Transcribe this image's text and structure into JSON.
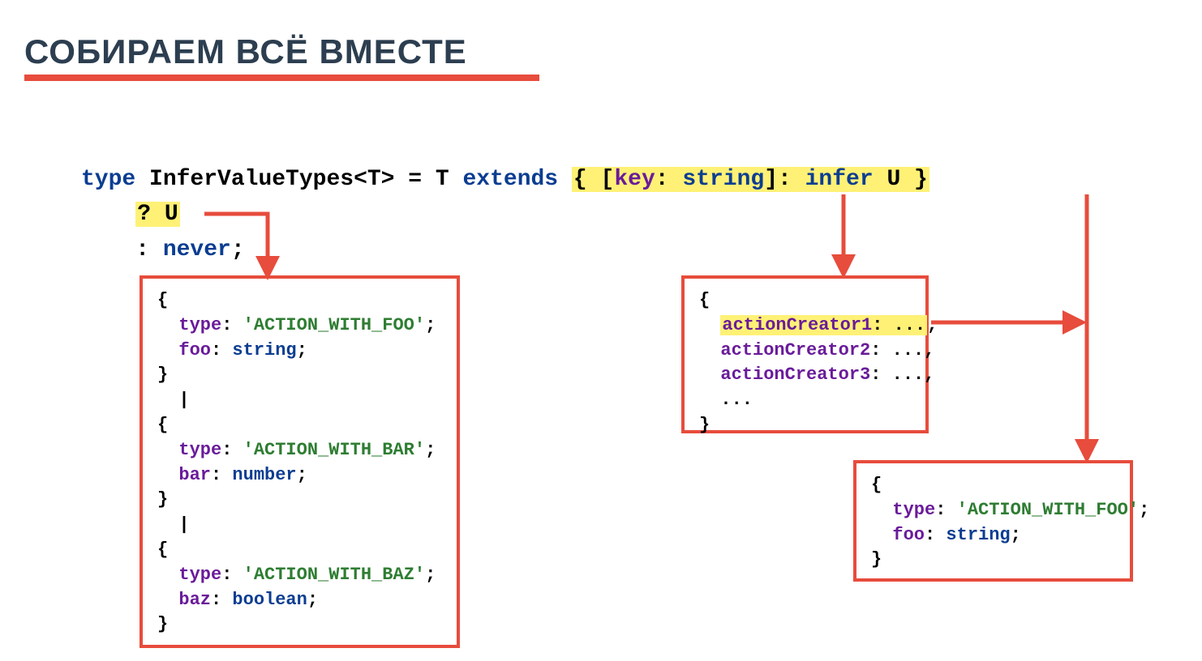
{
  "title": "СОБИРАЕМ ВСЁ ВМЕСТЕ",
  "code": {
    "t_type": "type",
    "t_name": " InferValueTypes<T> = T ",
    "t_extends": "extends",
    "t_space": " ",
    "t_hl1_a": "{ [",
    "t_hl1_key": "key",
    "t_hl1_b": ": ",
    "t_hl1_str": "string",
    "t_hl1_c": "]: ",
    "t_hl1_infer": "infer",
    "t_hl1_d": " U }",
    "l2_q": "? U",
    "l3_colon": ": ",
    "l3_never": "never",
    "l3_semi": ";"
  },
  "box1": {
    "o1": "{",
    "p1": "  type",
    "c1": ": ",
    "s1": "'ACTION_WITH_FOO'",
    "e1": ";",
    "p2": "  foo",
    "c2": ": ",
    "k2": "string",
    "e2": ";",
    "cl1": "}",
    "pipe1": "  |",
    "o2": "{",
    "p3": "  type",
    "c3": ": ",
    "s3": "'ACTION_WITH_BAR'",
    "e3": ";",
    "p4": "  bar",
    "c4": ": ",
    "k4": "number",
    "e4": ";",
    "cl2": "}",
    "pipe2": "  |",
    "o3": "{",
    "p5": "  type",
    "c5": ": ",
    "s5": "'ACTION_WITH_BAZ'",
    "e5": ";",
    "p6": "  baz",
    "c6": ": ",
    "k6": "boolean",
    "e6": ";",
    "cl3": "}"
  },
  "box2": {
    "o": "{",
    "a1": "actionCreator1",
    "a1s": ": ...",
    "a1c": ",",
    "a2": "  actionCreator2",
    "a2s": ": ...,",
    "a3": "  actionCreator3",
    "a3s": ": ...,",
    "dots": "  ...",
    "c": "}"
  },
  "box3": {
    "o": "{",
    "p1": "  type",
    "c1": ": ",
    "s1": "'ACTION_WITH_FOO'",
    "e1": ";",
    "p2": "  foo",
    "c2": ": ",
    "k2": "string",
    "e2": ";",
    "cl": "}"
  }
}
